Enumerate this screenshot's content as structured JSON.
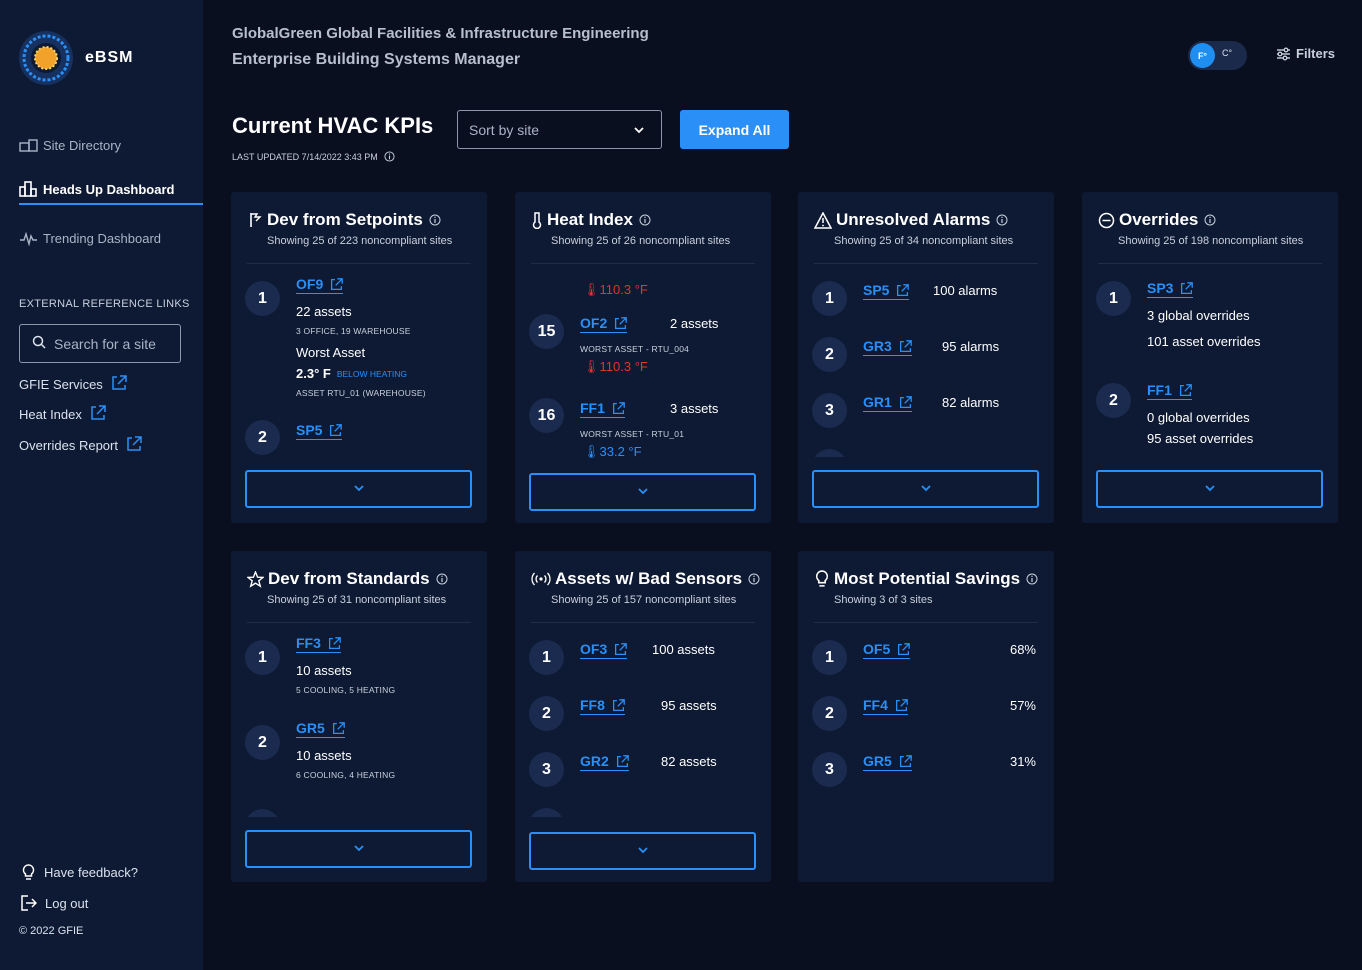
{
  "brand": {
    "name": "eBSM"
  },
  "header": {
    "org": "GlobalGreen Global Facilities & Infrastructure Engineering",
    "app": "Enterprise Building Systems Manager",
    "unit_f": "F°",
    "unit_c": "C°",
    "filters_label": "Filters"
  },
  "sidebar": {
    "nav": [
      {
        "label": "Site Directory",
        "icon": "building-icon",
        "active": false
      },
      {
        "label": "Heads Up Dashboard",
        "icon": "dashboard-icon",
        "active": true
      },
      {
        "label": "Trending Dashboard",
        "icon": "pulse-icon",
        "active": false
      }
    ],
    "ext_title": "EXTERNAL REFERENCE LINKS",
    "search_placeholder": "Search for a site",
    "ext_links": [
      "GFIE Services",
      "Heat Index",
      "Overrides Report"
    ],
    "feedback": "Have feedback?",
    "logout": "Log out",
    "copyright": "© 2022 GFIE"
  },
  "main": {
    "title": "Current HVAC KPIs",
    "updated": "LAST UPDATED 7/14/2022 3:43 PM",
    "sort_value": "Sort by site",
    "expand_label": "Expand All"
  },
  "cards": {
    "setpoints": {
      "title": "Dev from Setpoints",
      "subtitle": "Showing 25 of 223 noncompliant sites",
      "r1": {
        "rank": "1",
        "site": "OF9",
        "assets": "22 assets",
        "detail": "3 OFFICE, 19 WAREHOUSE",
        "worst_label": "Worst Asset",
        "worst_value": "2.3° F",
        "worst_badge": "BELOW HEATING",
        "worst_asset": "ASSET RTU_01 (WAREHOUSE)"
      },
      "r2": {
        "rank": "2",
        "site": "SP5"
      }
    },
    "heat": {
      "title": "Heat Index",
      "subtitle": "Showing 25 of 26 noncompliant sites",
      "top_temp": "110.3 °F",
      "r15": {
        "rank": "15",
        "site": "OF2",
        "assets": "2 assets",
        "worst": "WORST ASSET  - RTU_004",
        "temp": "110.3 °F"
      },
      "r16": {
        "rank": "16",
        "site": "FF1",
        "assets": "3 assets",
        "worst": "WORST ASSET - RTU_01",
        "temp": "33.2 °F"
      }
    },
    "alarms": {
      "title": "Unresolved Alarms",
      "subtitle": "Showing 25 of 34 noncompliant sites",
      "rows": [
        {
          "rank": "1",
          "site": "SP5",
          "value": "100 alarms"
        },
        {
          "rank": "2",
          "site": "GR3",
          "value": "95 alarms"
        },
        {
          "rank": "3",
          "site": "GR1",
          "value": "82 alarms"
        }
      ]
    },
    "overrides": {
      "title": "Overrides",
      "subtitle": "Showing 25 of 198 noncompliant sites",
      "r1": {
        "rank": "1",
        "site": "SP3",
        "global": "3 global overrides",
        "asset": "101 asset overrides"
      },
      "r2": {
        "rank": "2",
        "site": "FF1",
        "global": "0 global overrides",
        "asset": "95 asset overrides"
      }
    },
    "standards": {
      "title": "Dev from Standards",
      "subtitle": "Showing 25 of 31 noncompliant sites",
      "r1": {
        "rank": "1",
        "site": "FF3",
        "assets": "10 assets",
        "detail": "5 COOLING, 5 HEATING"
      },
      "r2": {
        "rank": "2",
        "site": "GR5",
        "assets": "10 assets",
        "detail": "6 COOLING, 4 HEATING"
      }
    },
    "sensors": {
      "title": "Assets w/ Bad Sensors",
      "subtitle": "Showing 25 of 157 noncompliant sites",
      "rows": [
        {
          "rank": "1",
          "site": "OF3",
          "value": "100 assets"
        },
        {
          "rank": "2",
          "site": "FF8",
          "value": "95 assets"
        },
        {
          "rank": "3",
          "site": "GR2",
          "value": "82 assets"
        }
      ]
    },
    "savings": {
      "title": "Most Potential Savings",
      "subtitle": "Showing 3 of 3 sites",
      "rows": [
        {
          "rank": "1",
          "site": "OF5",
          "value": "68%"
        },
        {
          "rank": "2",
          "site": "FF4",
          "value": "57%"
        },
        {
          "rank": "3",
          "site": "GR5",
          "value": "31%"
        }
      ]
    }
  },
  "colors": {
    "accent": "#2a8ff7",
    "alert": "#e5322d",
    "card": "#0e1a33",
    "background": "#0a0f20"
  }
}
